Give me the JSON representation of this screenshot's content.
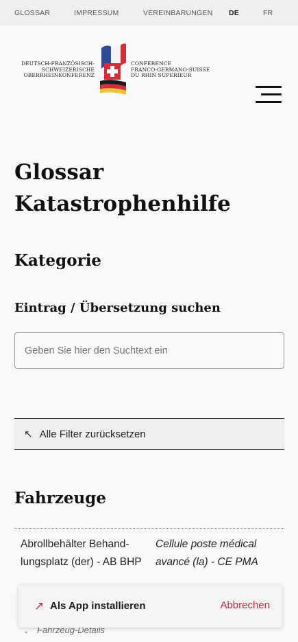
{
  "topnav": {
    "items": [
      "GLOSSAR",
      "IMPRESSUM",
      "VEREINBARUNGEN"
    ],
    "languages": [
      "DE",
      "FR"
    ],
    "active_language": "DE"
  },
  "logo": {
    "left_lines": [
      "DEUTSCH-FRANZÖSISCH-",
      "SCHWEIZERISCHE",
      "OBERRHEINKONFERENZ"
    ],
    "right_lines": [
      "CONFERENCE",
      "FRANCO-GERMANO-SUISSE",
      "DU RHIN SUPERIEUR"
    ]
  },
  "page": {
    "title_line1": "Glossar",
    "title_line2": "Katastrophenhilfe",
    "category_heading": "Kategorie",
    "search_heading": "Eintrag / Übersetzung suchen",
    "search_placeholder": "Geben Sie hier den Suchtext ein",
    "reset_label": "Alle Filter zurücksetzen"
  },
  "section": {
    "heading": "Fahrzeuge",
    "entries": [
      {
        "de": "Abrollbehälter Behand-lungsplatz (der) - AB BHP",
        "fr": "Cellule poste médical avancé (la) - CE PMA",
        "details_label": "Fahrzeug-Details"
      }
    ]
  },
  "install_banner": {
    "label": "Als App installieren",
    "cancel": "Abbrechen"
  },
  "colors": {
    "accent_red": "#d0263a",
    "topbar_bg": "#efeff0",
    "page_bg": "#f9f9fa"
  }
}
